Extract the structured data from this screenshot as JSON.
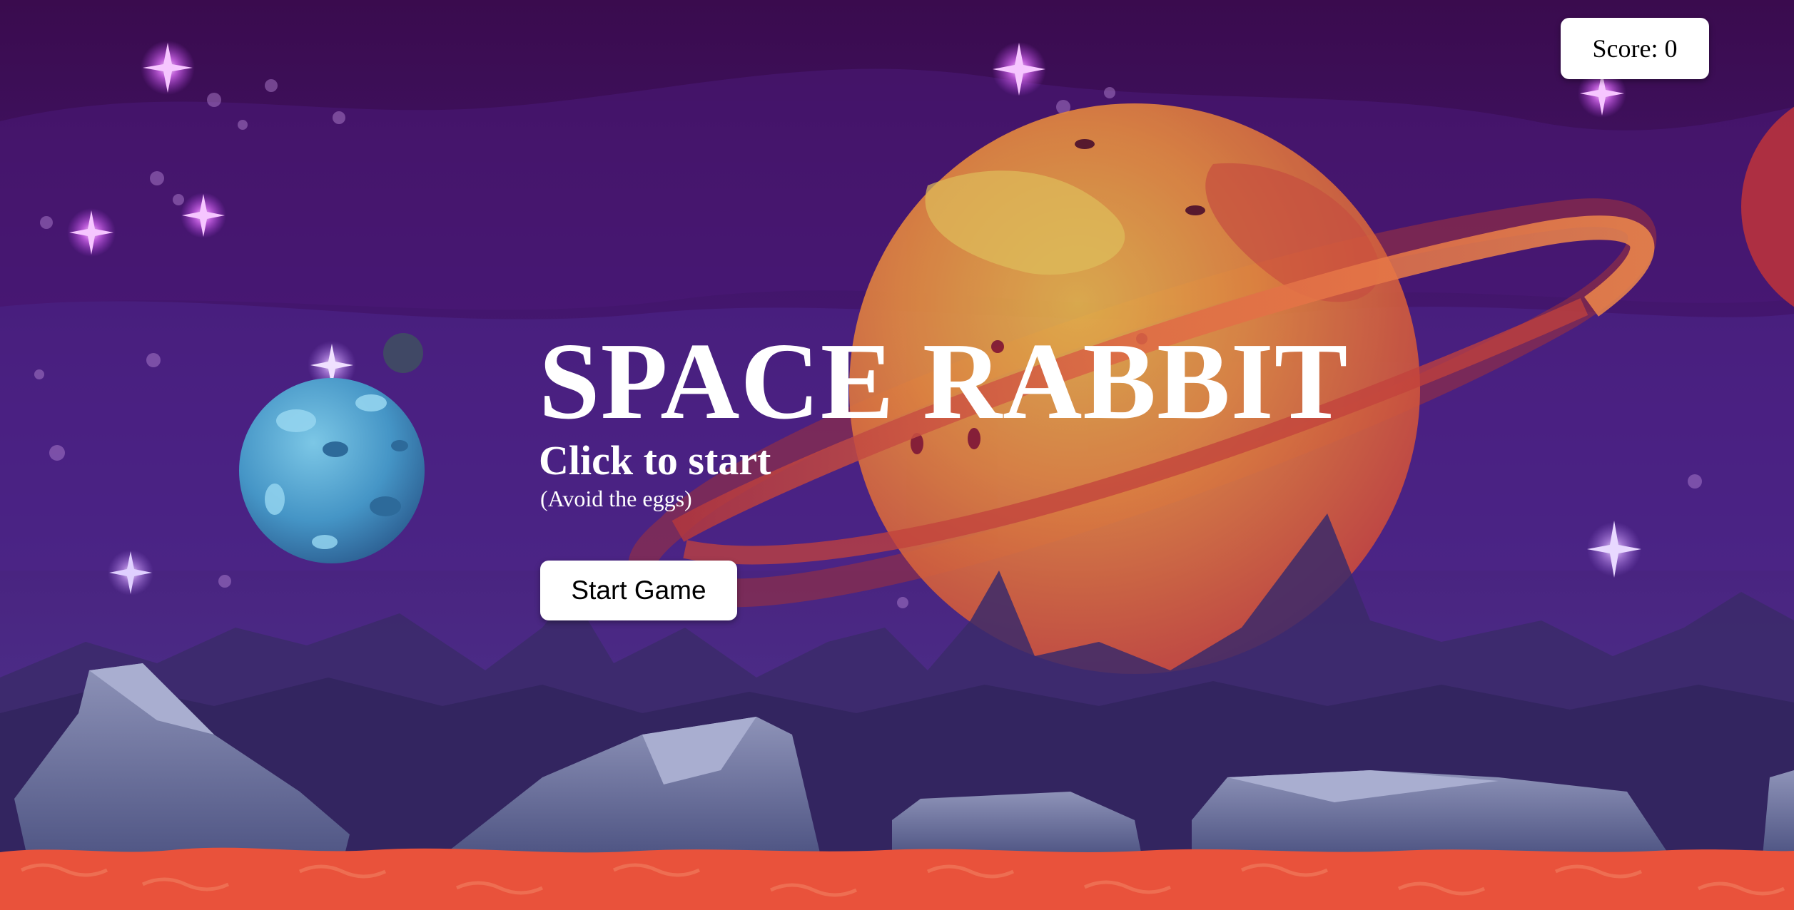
{
  "game": {
    "title": "SPACE RABBIT",
    "prompt": "Click to start",
    "hint": "(Avoid the eggs)",
    "start_button_label": "Start Game",
    "score_text": "Score: 0"
  },
  "scene": {
    "background": "purple-space-sky",
    "objects": [
      "ringed-planet",
      "cratered-moon",
      "stars",
      "rocks",
      "lava-ground"
    ]
  },
  "colors": {
    "sky_top": "#3a0b4e",
    "sky_mid": "#4a1c7e",
    "planet": "#e8703a",
    "moon": "#4a9bc9",
    "lava": "#e9523b"
  }
}
